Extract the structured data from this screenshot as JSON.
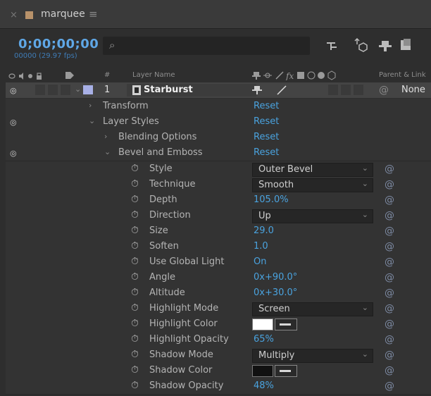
{
  "tab": {
    "close": "×",
    "title": "marquee",
    "menu": "≡"
  },
  "timecode": {
    "value": "0;00;00;00",
    "frames": "00000 (29.97 fps)"
  },
  "search": {
    "icon": "⌕"
  },
  "columns": {
    "number": "#",
    "layer_name": "Layer Name",
    "parent_link": "Parent & Link"
  },
  "layer": {
    "number": "1",
    "name": "Starburst",
    "parent": "None"
  },
  "groups": {
    "transform": {
      "label": "Transform",
      "reset": "Reset"
    },
    "layer_styles": {
      "label": "Layer Styles",
      "reset": "Reset"
    },
    "blending": {
      "label": "Blending Options",
      "reset": "Reset"
    },
    "bevel": {
      "label": "Bevel and Emboss",
      "reset": "Reset"
    }
  },
  "properties": [
    {
      "label": "Style",
      "value": "Outer Bevel",
      "type": "dropdown"
    },
    {
      "label": "Technique",
      "value": "Smooth",
      "type": "dropdown"
    },
    {
      "label": "Depth",
      "value": "105.0%",
      "type": "value"
    },
    {
      "label": "Direction",
      "value": "Up",
      "type": "dropdown"
    },
    {
      "label": "Size",
      "value": "29.0",
      "type": "value"
    },
    {
      "label": "Soften",
      "value": "1.0",
      "type": "value"
    },
    {
      "label": "Use Global Light",
      "value": "On",
      "type": "value"
    },
    {
      "label": "Angle",
      "value": "0x+90.0°",
      "type": "value"
    },
    {
      "label": "Altitude",
      "value": "0x+30.0°",
      "type": "value"
    },
    {
      "label": "Highlight Mode",
      "value": "Screen",
      "type": "dropdown"
    },
    {
      "label": "Highlight Color",
      "value": "",
      "type": "color",
      "color": "#ffffff"
    },
    {
      "label": "Highlight Opacity",
      "value": "65%",
      "type": "value"
    },
    {
      "label": "Shadow Mode",
      "value": "Multiply",
      "type": "dropdown"
    },
    {
      "label": "Shadow Color",
      "value": "",
      "type": "color",
      "color": "#111111"
    },
    {
      "label": "Shadow Opacity",
      "value": "48%",
      "type": "value"
    }
  ],
  "colors": {
    "accent": "#4aa3df",
    "timecode": "#5fa7e6",
    "label_swatch": "#b8926a"
  }
}
